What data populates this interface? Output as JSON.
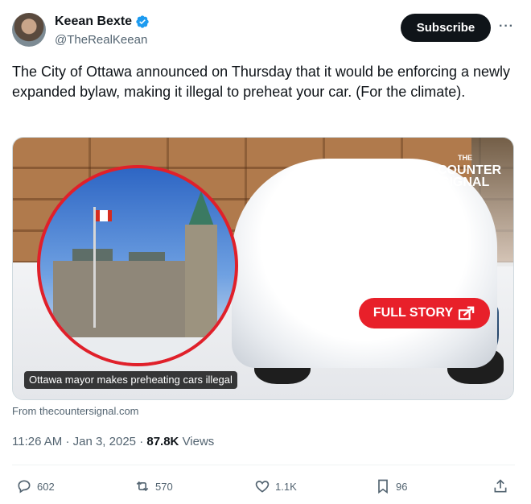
{
  "author": {
    "display_name": "Keean Bexte",
    "handle": "@TheRealKeean",
    "verified_icon": "verified-badge-icon"
  },
  "header": {
    "subscribe_label": "Subscribe",
    "more_icon": "more-horizontal-icon",
    "more_label": "···"
  },
  "tweet": {
    "text": "The City of Ottawa announced on Thursday that it would be enforcing a newly expanded bylaw, making it illegal to preheat your car. (For the climate)."
  },
  "media": {
    "brand_line1": "THE",
    "brand_line2": "COUNTER",
    "brand_line3": "SIGNAL",
    "cta_label": "FULL STORY",
    "caption": "Ottawa mayor makes preheating cars illegal"
  },
  "source": "From thecountersignal.com",
  "meta": {
    "time": "11:26 AM",
    "separator": "·",
    "date": "Jan 3, 2025",
    "views_count": "87.8K",
    "views_label": "Views"
  },
  "actions": {
    "replies": "602",
    "reposts": "570",
    "likes": "1.1K",
    "bookmarks": "96"
  },
  "colors": {
    "accent": "#1d9bf0",
    "subscribe_bg": "#0f1419",
    "cta_red": "#e8202a",
    "muted": "#536471"
  }
}
